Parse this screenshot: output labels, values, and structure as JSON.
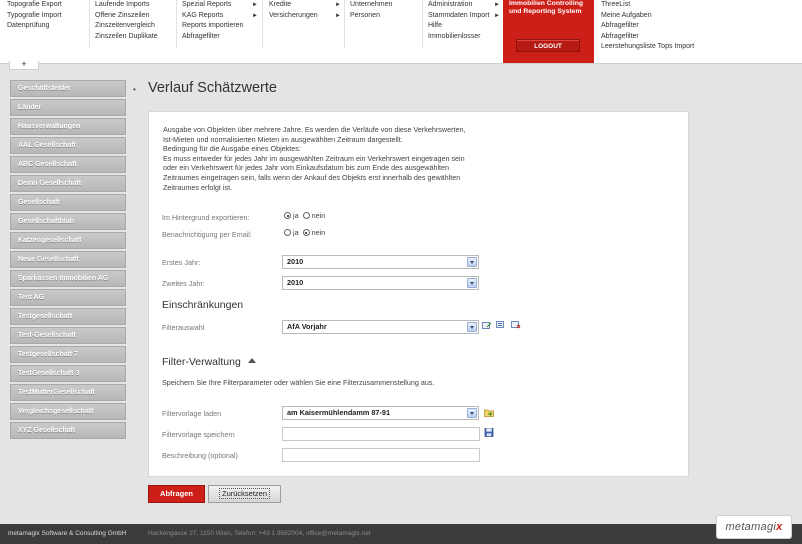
{
  "topmenu": {
    "col1": [
      "Topografie Export",
      "Typografie Import",
      "Datenprüfung"
    ],
    "col2": [
      "Laufende Imports",
      "Offene Zinszeilen",
      "Zinszeitenvergleich",
      "Zinszeilen Duplikate"
    ],
    "col3": [
      "Spezial Reports",
      "KAG Reports",
      "Reports importieren",
      "Abfragefilter"
    ],
    "col4": [
      "Kredite",
      "Versicherungen"
    ],
    "col5": [
      "Unternehmen",
      "Personen"
    ],
    "col6": [
      "Administration",
      "Stammdaten Import",
      "Hilfe",
      "Immobilienlosser"
    ],
    "col7": [
      "ThreeList",
      "Meine Aufgaben",
      "Abfragefilter",
      "Abfragefilter",
      "Leerstehungsliste Tops Import"
    ],
    "brand": "Immobilien Controlling und Reporting System",
    "logout": "LOGOUT",
    "plus": "+"
  },
  "sidebar": {
    "items": [
      "Geschäftsfelder",
      "Länder",
      "Hausverwaltungen",
      "AAL Gesellschaft",
      "ABC Gesellschaft",
      "Demo Gesellschaft",
      "Gesellschaft",
      "Gesellschaftblah",
      "Katzengesellschaft",
      "Neue Gesellschaft",
      "Sparkassen Immobilien AG",
      "Test AG",
      "Testgesellschaft",
      "Test-Gesellschaft",
      "Testgesellschaft 7",
      "TestGesellschaft 3",
      "TestMutterGesellschaft",
      "Vergleichsgesellschaft",
      "XYZ Gesellschaft"
    ]
  },
  "page": {
    "title": "Verlauf Schätzwerte",
    "description": [
      "Ausgabe von Objekten über mehrere Jahre. Es werden die Verläufe von diese Verkehrswerten,",
      "Ist-Mieten und normalisierten Mieten im ausgewählten Zeitraum dargestellt.",
      "Bedingung für die Ausgabe eines Objektes:",
      "Es muss entweder für jedes Jahr im ausgewählten Zeitraum ein Verkehrswert eingetragen sein",
      "oder ein Verkehrswert für jedes Jahr vom Einkaufsdatum bis zum Ende des ausgewählten",
      "Zeitraumes eingetragen sein, falls wenn der Ankauf des Objekts erst innerhalb des gewählten",
      "Zeitraumes erfolgt ist."
    ]
  },
  "form": {
    "export_label": "Im Hintergrund exportieren:",
    "export_yes": "ja",
    "export_no": "nein",
    "notify_label": "Benachrichtigung per Email:",
    "notify_yes": "ja",
    "notify_no": "nein",
    "first_year_label": "Erstes Jahr:",
    "first_year_value": "2010",
    "second_year_label": "Zweites Jahr:",
    "second_year_value": "2010",
    "restrictions_title": "Einschränkungen",
    "filter_select_label": "Filterauswahl",
    "filter_select_value": "AfA Vorjahr",
    "filter_admin_title": "Filter-Verwaltung",
    "filter_admin_hint": "Speichern Sie Ihre Filterparameter oder wählen Sie eine Filterzusammenstellung aus.",
    "template_load_label": "Filtervorlage laden",
    "template_load_value": "am Kaisermühlendamm 87-91",
    "template_save_label": "Filtervorlage speichern",
    "description_label": "Beschreibung (optional)"
  },
  "buttons": {
    "submit": "Abfragen",
    "reset": "Zurücksetzen"
  },
  "footer": {
    "company": "metamagix Software & Consulting GmbH",
    "address": "Hackengasse 27, 1150 Wien, Telefon: +43 1 9582004, office@metamagix.net",
    "logo_text": "metamagi",
    "logo_accent": "x"
  },
  "colors": {
    "accent": "#cc1f18",
    "sidebar": "#bfbfbf",
    "footer": "#3c3c3c"
  }
}
